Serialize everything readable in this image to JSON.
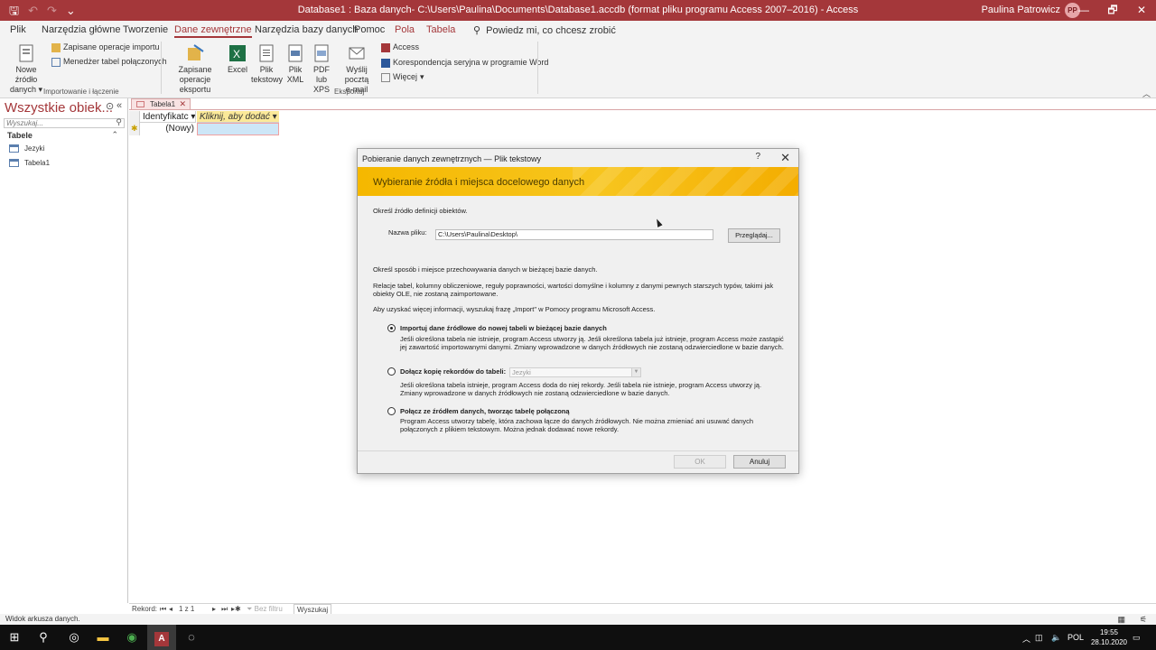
{
  "window": {
    "title": "Database1 : Baza danych- C:\\Users\\Paulina\\Documents\\Database1.accdb (format pliku programu Access 2007–2016)  -  Access",
    "user": "Paulina Patrowicz",
    "avatar": "PP",
    "min": "—",
    "max": "🗗",
    "close": "✕"
  },
  "qat": {
    "save": "🖫",
    "undo": "↶",
    "redo": "↷",
    "more": "⌄"
  },
  "tabs": [
    {
      "label": "Plik"
    },
    {
      "label": "Narzędzia główne"
    },
    {
      "label": "Tworzenie"
    },
    {
      "label": "Dane zewnętrzne"
    },
    {
      "label": "Narzędzia bazy danych"
    },
    {
      "label": "Pomoc"
    },
    {
      "label": "Pola"
    },
    {
      "label": "Tabela"
    },
    {
      "label": "Powiedz mi, co chcesz zrobić"
    }
  ],
  "ribbon": {
    "import_group": {
      "new_source": "Nowe źródło",
      "new_source_2": "danych",
      "saved_imports": "Zapisane operacje importu",
      "linked_table_manager": "Menedżer tabel połączonych",
      "label": "Importowanie i łączenie"
    },
    "export_group": {
      "saved_exports": "Zapisane",
      "saved_exports_2": "operacje eksportu",
      "excel": "Excel",
      "text_file": "Plik",
      "text_file_2": "tekstowy",
      "xml_file": "Plik",
      "xml_file_2": "XML",
      "pdf_xps": "PDF",
      "pdf_xps_2": "lub XPS",
      "email": "Wyślij pocztą",
      "email_2": "e-mail",
      "access": "Access",
      "word_merge": "Korespondencja seryjna w programie Word",
      "more": "Więcej",
      "label": "Eksportuj"
    }
  },
  "nav": {
    "title": "Wszystkie obiek...",
    "search_placeholder": "Wyszukaj...",
    "category": "Tabele",
    "items": [
      "Jezyki",
      "Tabela1"
    ]
  },
  "document": {
    "tab": "Tabela1",
    "col1": "Identyfikatc",
    "col2": "Kliknij, aby dodać",
    "new_row": "(Nowy)"
  },
  "recordbar": {
    "label": "Rekord:",
    "position": "1 z 1",
    "filter": "Bez filtru",
    "search": "Wyszukaj"
  },
  "status": {
    "text": "Widok arkusza danych."
  },
  "dialog": {
    "title": "Pobieranie danych zewnętrznych — Plik tekstowy",
    "banner": "Wybieranie źródła i miejsca docelowego danych",
    "source_label": "Określ źródło definicji obiektów.",
    "filename_label": "Nazwa pliku:",
    "filename_value": "C:\\Users\\Paulina\\Desktop\\",
    "browse": "Przeglądaj...",
    "storage_label": "Określ sposób i miejsce przechowywania danych w bieżącej bazie danych.",
    "relations_note": "Relacje tabel, kolumny obliczeniowe, reguły poprawności, wartości domyślne i kolumny z danymi pewnych starszych typów, takimi jak obiekty OLE, nie zostaną zaimportowane.",
    "help_note": "Aby uzyskać więcej informacji, wyszukaj frazę „Import\" w Pomocy programu Microsoft Access.",
    "option1": "Importuj dane źródłowe do nowej tabeli w bieżącej bazie danych",
    "option1_desc": "Jeśli określona tabela nie istnieje, program Access utworzy ją. Jeśli określona tabela już istnieje, program Access może zastąpić jej zawartość importowanymi danymi. Zmiany wprowadzone w danych źródłowych nie zostaną odzwierciedlone w bazie danych.",
    "option2": "Dołącz kopię rekordów do tabeli:",
    "option2_combo": "Jezyki",
    "option2_desc": "Jeśli określona tabela istnieje, program Access doda do niej rekordy. Jeśli tabela nie istnieje, program Access utworzy ją. Zmiany wprowadzone w danych źródłowych nie zostaną odzwierciedlone w bazie danych.",
    "option3": "Połącz ze źródłem danych, tworząc tabelę połączoną",
    "option3_desc": "Program Access utworzy tabelę, która zachowa łącze do danych źródłowych. Nie można zmieniać ani usuwać danych połączonych z plikiem tekstowym. Można jednak dodawać nowe rekordy.",
    "ok": "OK",
    "cancel": "Anuluj",
    "help": "?",
    "close": "✕"
  },
  "taskbar": {
    "lang": "POL",
    "time": "19:55",
    "date": "28.10.2020"
  },
  "colors": {
    "accent": "#a4373a",
    "banner": "#f5b800"
  }
}
